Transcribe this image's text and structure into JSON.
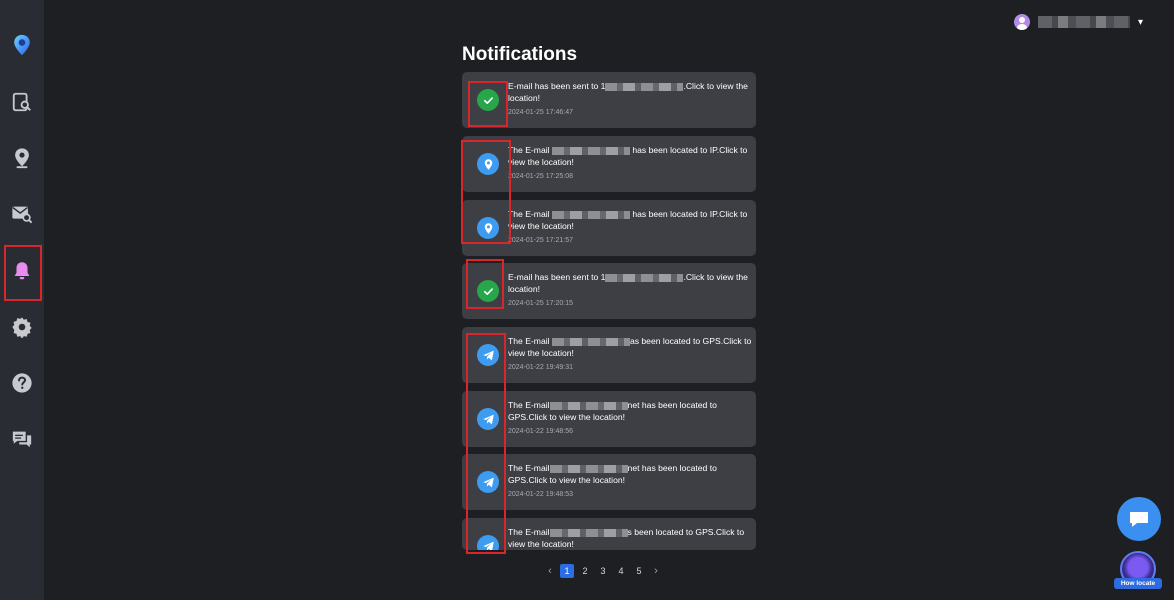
{
  "page": {
    "title": "Notifications"
  },
  "sidebar": {
    "items": [
      {
        "name": "logo",
        "icon": "location-pin-logo-icon"
      },
      {
        "name": "device-search",
        "icon": "device-search-icon"
      },
      {
        "name": "location",
        "icon": "location-pin-icon"
      },
      {
        "name": "mail-search",
        "icon": "mail-search-icon"
      },
      {
        "name": "notifications",
        "icon": "bell-icon",
        "active": true
      },
      {
        "name": "settings",
        "icon": "gear-icon"
      },
      {
        "name": "help",
        "icon": "help-icon"
      },
      {
        "name": "messages",
        "icon": "chat-icon"
      }
    ]
  },
  "user": {
    "caret": "▾"
  },
  "notifications": [
    {
      "type": "check",
      "text_before": "E-mail has been sent to 1",
      "text_after": ".Click to view the location!",
      "time": "2024-01-25 17:46:47"
    },
    {
      "type": "pin",
      "text_before": "The E-mail ",
      "text_after": " has been located to IP.Click to view the location!",
      "time": "2024-01-25 17:25:08"
    },
    {
      "type": "pin",
      "text_before": "The E-mail ",
      "text_after": " has been located to IP.Click to view the location!",
      "time": "2024-01-25 17:21:57"
    },
    {
      "type": "check",
      "text_before": "E-mail has been sent to 1",
      "text_after": ".Click to view the location!",
      "time": "2024-01-25 17:20:15"
    },
    {
      "type": "plane",
      "text_before": "The E-mail ",
      "text_after": "as been located to GPS.Click to view the location!",
      "time": "2024-01-22 19:49:31"
    },
    {
      "type": "plane",
      "text_before": "The E-mail",
      "text_after": "net has been located to GPS.Click to view the location!",
      "time": "2024-01-22 19:48:56"
    },
    {
      "type": "plane",
      "text_before": "The E-mail",
      "text_after": "net has been located to GPS.Click to view the location!",
      "time": "2024-01-22 19:48:53"
    },
    {
      "type": "plane",
      "text_before": "The E-mail",
      "text_after": "s been located to GPS.Click to view the location!",
      "time": ""
    }
  ],
  "pagination": {
    "prev": "‹",
    "next": "›",
    "pages": [
      "1",
      "2",
      "3",
      "4",
      "5"
    ],
    "current": "1"
  },
  "fab": {
    "howto_label": "How locate"
  },
  "colors": {
    "check": "#27a74a",
    "pin": "#3d9cf0",
    "plane": "#3d9cf0",
    "active_page": "#2a6de4",
    "highlight_box": "#d9262b"
  }
}
